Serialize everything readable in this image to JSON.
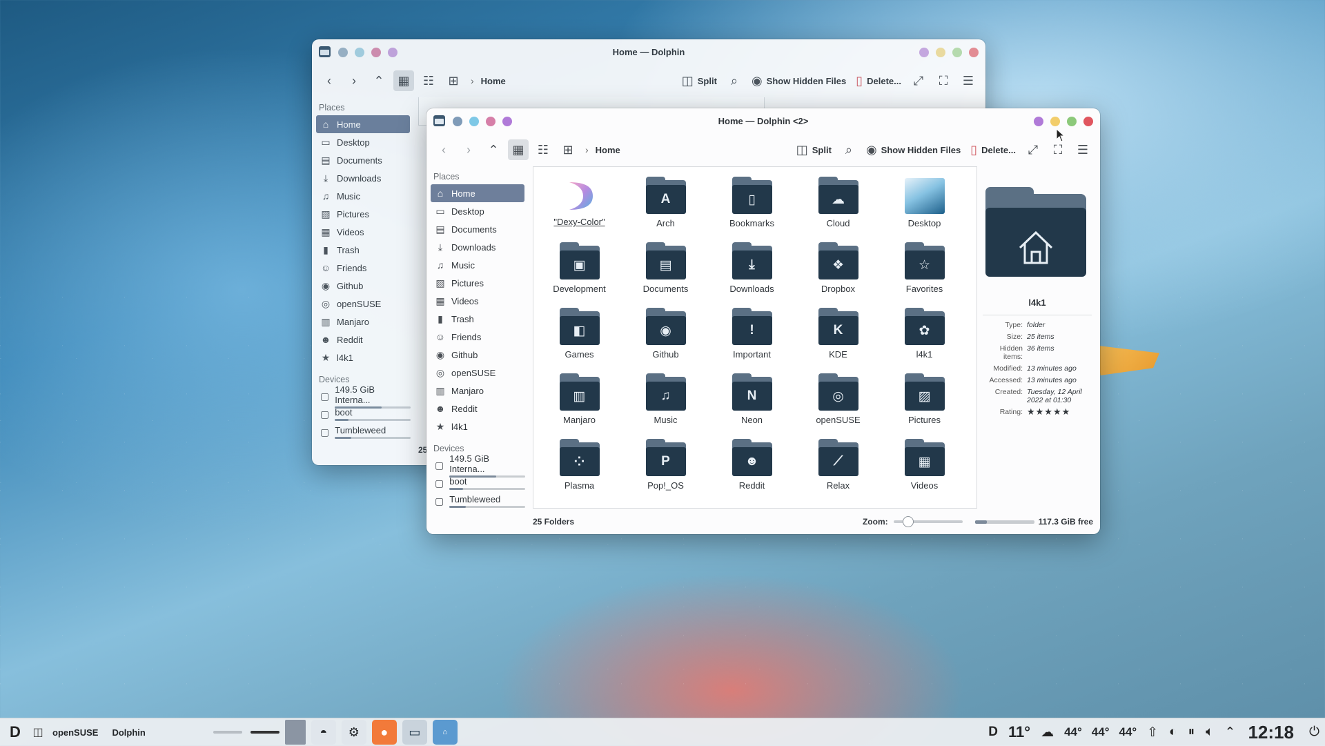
{
  "back_window": {
    "title": "Home — Dolphin",
    "breadcrumb": "Home",
    "toolbar": {
      "split": "Split",
      "show_hidden": "Show Hidden Files",
      "delete": "Delete..."
    },
    "places_header": "Places",
    "places": [
      {
        "label": "Home",
        "icon": "home-icon"
      },
      {
        "label": "Desktop",
        "icon": "desktop-icon"
      },
      {
        "label": "Documents",
        "icon": "documents-icon"
      },
      {
        "label": "Downloads",
        "icon": "downloads-icon"
      },
      {
        "label": "Music",
        "icon": "music-icon"
      },
      {
        "label": "Pictures",
        "icon": "pictures-icon"
      },
      {
        "label": "Videos",
        "icon": "videos-icon"
      },
      {
        "label": "Trash",
        "icon": "trash-icon"
      },
      {
        "label": "Friends",
        "icon": "friends-icon"
      },
      {
        "label": "Github",
        "icon": "github-icon"
      },
      {
        "label": "openSUSE",
        "icon": "opensuse-icon"
      },
      {
        "label": "Manjaro",
        "icon": "manjaro-icon"
      },
      {
        "label": "Reddit",
        "icon": "reddit-icon"
      },
      {
        "label": "l4k1",
        "icon": "star-icon"
      }
    ],
    "devices_header": "Devices",
    "devices": [
      {
        "label": "149.5 GiB Interna...",
        "usage": 0.62
      },
      {
        "label": "boot",
        "usage": 0.18
      },
      {
        "label": "Tumbleweed",
        "usage": 0.22
      }
    ],
    "status_fragment": "25"
  },
  "front_window": {
    "title": "Home — Dolphin <2>",
    "breadcrumb": "Home",
    "toolbar": {
      "split": "Split",
      "show_hidden": "Show Hidden Files",
      "delete": "Delete..."
    },
    "places_header": "Places",
    "places": [
      {
        "label": "Home",
        "icon": "home-icon"
      },
      {
        "label": "Desktop",
        "icon": "desktop-icon"
      },
      {
        "label": "Documents",
        "icon": "documents-icon"
      },
      {
        "label": "Downloads",
        "icon": "downloads-icon"
      },
      {
        "label": "Music",
        "icon": "music-icon"
      },
      {
        "label": "Pictures",
        "icon": "pictures-icon"
      },
      {
        "label": "Videos",
        "icon": "videos-icon"
      },
      {
        "label": "Trash",
        "icon": "trash-icon"
      },
      {
        "label": "Friends",
        "icon": "friends-icon"
      },
      {
        "label": "Github",
        "icon": "github-icon"
      },
      {
        "label": "openSUSE",
        "icon": "opensuse-icon"
      },
      {
        "label": "Manjaro",
        "icon": "manjaro-icon"
      },
      {
        "label": "Reddit",
        "icon": "reddit-icon"
      },
      {
        "label": "l4k1",
        "icon": "star-icon"
      }
    ],
    "devices_header": "Devices",
    "devices": [
      {
        "label": "149.5 GiB Interna...",
        "usage": 0.62
      },
      {
        "label": "boot",
        "usage": 0.18
      },
      {
        "label": "Tumbleweed",
        "usage": 0.22
      }
    ],
    "files": [
      {
        "name": "\"Dexy-Color\"",
        "glyph": ""
      },
      {
        "name": "Arch",
        "glyph": "A"
      },
      {
        "name": "Bookmarks",
        "glyph": "▯"
      },
      {
        "name": "Cloud",
        "glyph": "☁"
      },
      {
        "name": "Desktop",
        "glyph": ""
      },
      {
        "name": "Development",
        "glyph": "▣"
      },
      {
        "name": "Documents",
        "glyph": "▤"
      },
      {
        "name": "Downloads",
        "glyph": "⤓"
      },
      {
        "name": "Dropbox",
        "glyph": "❖"
      },
      {
        "name": "Favorites",
        "glyph": "☆"
      },
      {
        "name": "Games",
        "glyph": "◧"
      },
      {
        "name": "Github",
        "glyph": "◉"
      },
      {
        "name": "Important",
        "glyph": "!"
      },
      {
        "name": "KDE",
        "glyph": "K"
      },
      {
        "name": "l4k1",
        "glyph": "✿"
      },
      {
        "name": "Manjaro",
        "glyph": "▥"
      },
      {
        "name": "Music",
        "glyph": "♫"
      },
      {
        "name": "Neon",
        "glyph": "N"
      },
      {
        "name": "openSUSE",
        "glyph": "◎"
      },
      {
        "name": "Pictures",
        "glyph": "▨"
      },
      {
        "name": "Plasma",
        "glyph": "⁘"
      },
      {
        "name": "Pop!_OS",
        "glyph": "P"
      },
      {
        "name": "Reddit",
        "glyph": "☻"
      },
      {
        "name": "Relax",
        "glyph": "⟋"
      },
      {
        "name": "Videos",
        "glyph": "▦"
      }
    ],
    "info": {
      "name": "l4k1",
      "rows": [
        {
          "k": "Type:",
          "v": "folder"
        },
        {
          "k": "Size:",
          "v": "25 items"
        },
        {
          "k": "Hidden items:",
          "v": "36 items"
        },
        {
          "k": "Modified:",
          "v": "13 minutes ago"
        },
        {
          "k": "Accessed:",
          "v": "13 minutes ago"
        },
        {
          "k": "Created:",
          "v": "Tuesday, 12 April 2022 at 01:30"
        }
      ],
      "rating_label": "Rating:",
      "rating": 5
    },
    "status": {
      "folders": "25 Folders",
      "zoom_label": "Zoom:",
      "free": "117.3 GiB free",
      "zoom_level": 0.2,
      "disk_usage": 0.2
    }
  },
  "taskbar": {
    "task1": "openSUSE",
    "task2": "Dolphin",
    "weather_temp": "11°",
    "temps": [
      "44°",
      "44°",
      "44°"
    ],
    "clock": "12:18"
  },
  "colors": {
    "accent": "#6e7f9b",
    "folder_front": "#22384a",
    "folder_back": "#5b7084",
    "btn_red": "#e0565f",
    "btn_green": "#8cc97a",
    "btn_yellow": "#f2cd6b",
    "btn_purple": "#c98bd0"
  }
}
